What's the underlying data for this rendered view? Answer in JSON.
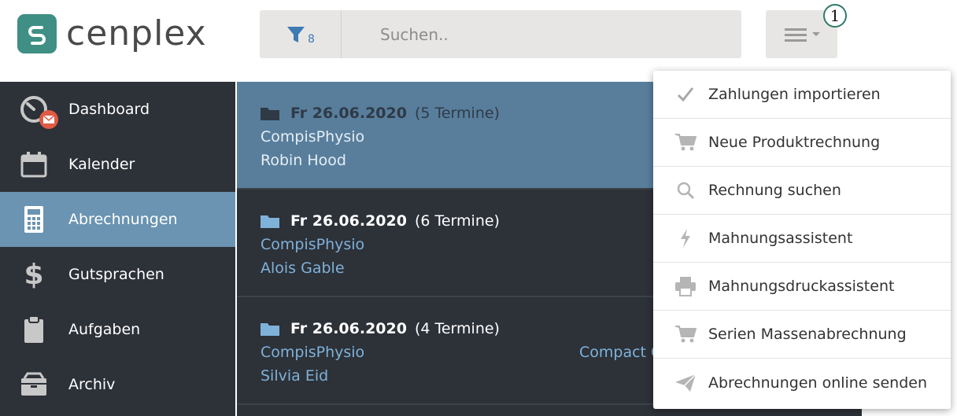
{
  "header": {
    "logo_text": "cenplex",
    "filter_count": "8",
    "search_placeholder": "Suchen..",
    "step_badge": "1"
  },
  "sidebar": {
    "items": [
      {
        "label": "Dashboard",
        "icon": "dashboard-gauge-icon",
        "active": false
      },
      {
        "label": "Kalender",
        "icon": "calendar-icon",
        "active": false
      },
      {
        "label": "Abrechnungen",
        "icon": "calculator-icon",
        "active": true
      },
      {
        "label": "Gutsprachen",
        "icon": "dollar-icon",
        "active": false
      },
      {
        "label": "Aufgaben",
        "icon": "clipboard-icon",
        "active": false
      },
      {
        "label": "Archiv",
        "icon": "archive-icon",
        "active": false
      }
    ]
  },
  "list": {
    "entries": [
      {
        "date": "Fr 26.06.2020",
        "count": "(5 Termine)",
        "practice": "CompisPhysio",
        "patient": "Robin Hood",
        "extra": "",
        "selected": true
      },
      {
        "date": "Fr 26.06.2020",
        "count": "(6 Termine)",
        "practice": "CompisPhysio",
        "patient": "Alois Gable",
        "extra": "",
        "selected": false
      },
      {
        "date": "Fr 26.06.2020",
        "count": "(4 Termine)",
        "practice": "CompisPhysio",
        "patient": "Silvia Eid",
        "extra": "Compact C",
        "selected": false
      }
    ]
  },
  "dropdown": {
    "items": [
      {
        "label": "Zahlungen importieren",
        "icon": "checkmark-icon"
      },
      {
        "label": "Neue Produktrechnung",
        "icon": "cart-icon"
      },
      {
        "label": "Rechnung suchen",
        "icon": "search-icon"
      },
      {
        "label": "Mahnungsassistent",
        "icon": "bolt-icon"
      },
      {
        "label": "Mahnungsdruckassistent",
        "icon": "printer-icon"
      },
      {
        "label": "Serien Massenabrechnung",
        "icon": "cart-icon"
      },
      {
        "label": "Abrechnungen online senden",
        "icon": "paper-plane-icon"
      }
    ]
  },
  "colors": {
    "brand": "#3f8f84",
    "sidebar_bg": "#2d3138",
    "active_nav": "#6a94b1",
    "selected_entry": "#587e9c",
    "link_blue": "#7fb2d9",
    "badge_red": "#e05a44"
  }
}
